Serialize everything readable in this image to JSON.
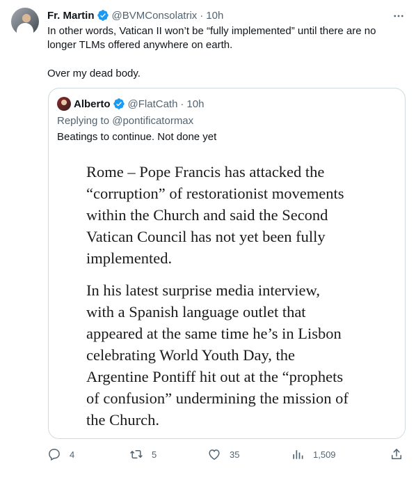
{
  "author": {
    "name": "Fr. Martin",
    "handle": "@BVMConsolatrix",
    "separator": "·",
    "time": "10h",
    "verified_color": "#1d9bf0"
  },
  "tweet": {
    "line1": "In other words, Vatican II won’t be “fully implemented” until there are no",
    "line2": "longer TLMs offered anywhere on earth.",
    "line3": "Over my dead body."
  },
  "quote": {
    "name": "Alberto",
    "handle": "@FlatCath",
    "separator": "·",
    "time": "10h",
    "replying_to": "Replying to @pontificatormax",
    "text": "Beatings to continue. Not done yet",
    "image_text": {
      "para1": [
        "Rome – Pope Francis has attacked the",
        "“corruption” of restorationist movements",
        "within the Church and said the Second",
        "Vatican Council has not yet been fully",
        "implemented."
      ],
      "para2": [
        "In his latest surprise media interview,",
        "with a Spanish language outlet that",
        "appeared at the same time he’s in Lisbon",
        "celebrating World Youth Day, the",
        "Argentine Pontiff hit out at the “prophets",
        "of confusion” undermining the mission of",
        "the Church."
      ]
    }
  },
  "actions": {
    "replies": "4",
    "reposts": "5",
    "likes": "35",
    "views": "1,509"
  },
  "icons": {
    "more": "more-icon",
    "reply": "reply-icon",
    "repost": "repost-icon",
    "like": "like-icon",
    "views": "views-icon",
    "share": "share-icon"
  }
}
